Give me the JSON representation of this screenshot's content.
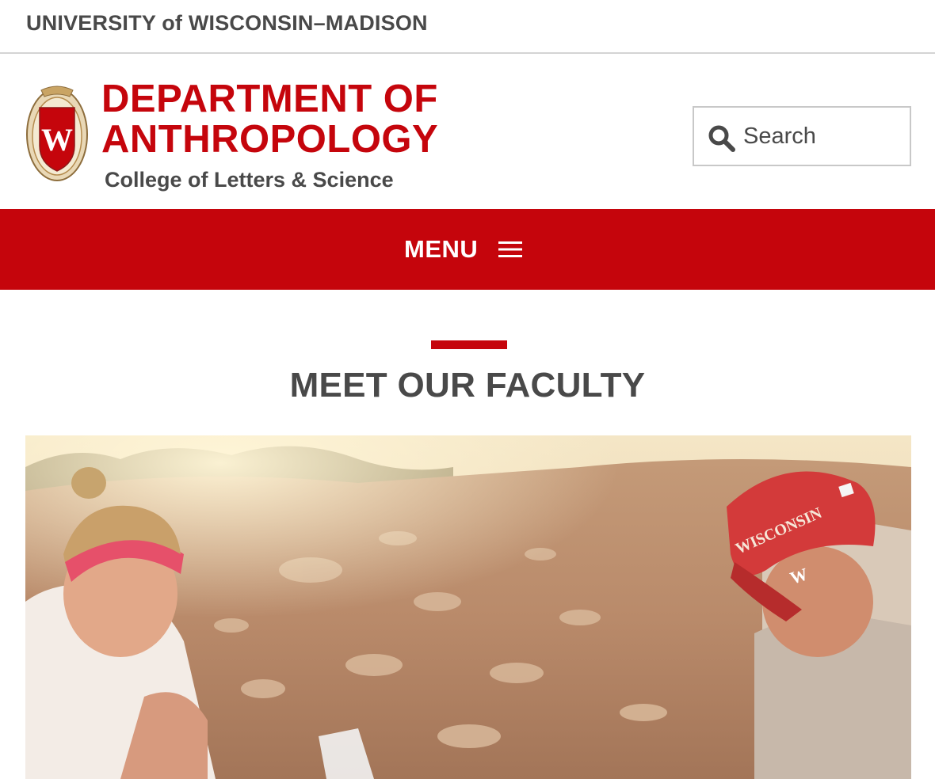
{
  "university": {
    "title": "UNIVERSITY of WISCONSIN–MADISON"
  },
  "department": {
    "title_line1": "DEPARTMENT OF",
    "title_line2": "ANTHROPOLOGY",
    "subtitle": "College of Letters & Science",
    "crest_letter": "W"
  },
  "search": {
    "placeholder": "Search",
    "value": "",
    "icon": "search-icon"
  },
  "menu": {
    "label": "MENU",
    "icon": "hamburger-icon"
  },
  "section": {
    "title": "MEET OUR FACULTY"
  },
  "hero": {
    "description": "Students excavating at an archaeological dig site",
    "cap_text": "WISCONSIN",
    "cap_letter": "W"
  },
  "colors": {
    "brand_red": "#c5050c",
    "text_gray": "#494949",
    "border_gray": "#c8c8c8"
  }
}
